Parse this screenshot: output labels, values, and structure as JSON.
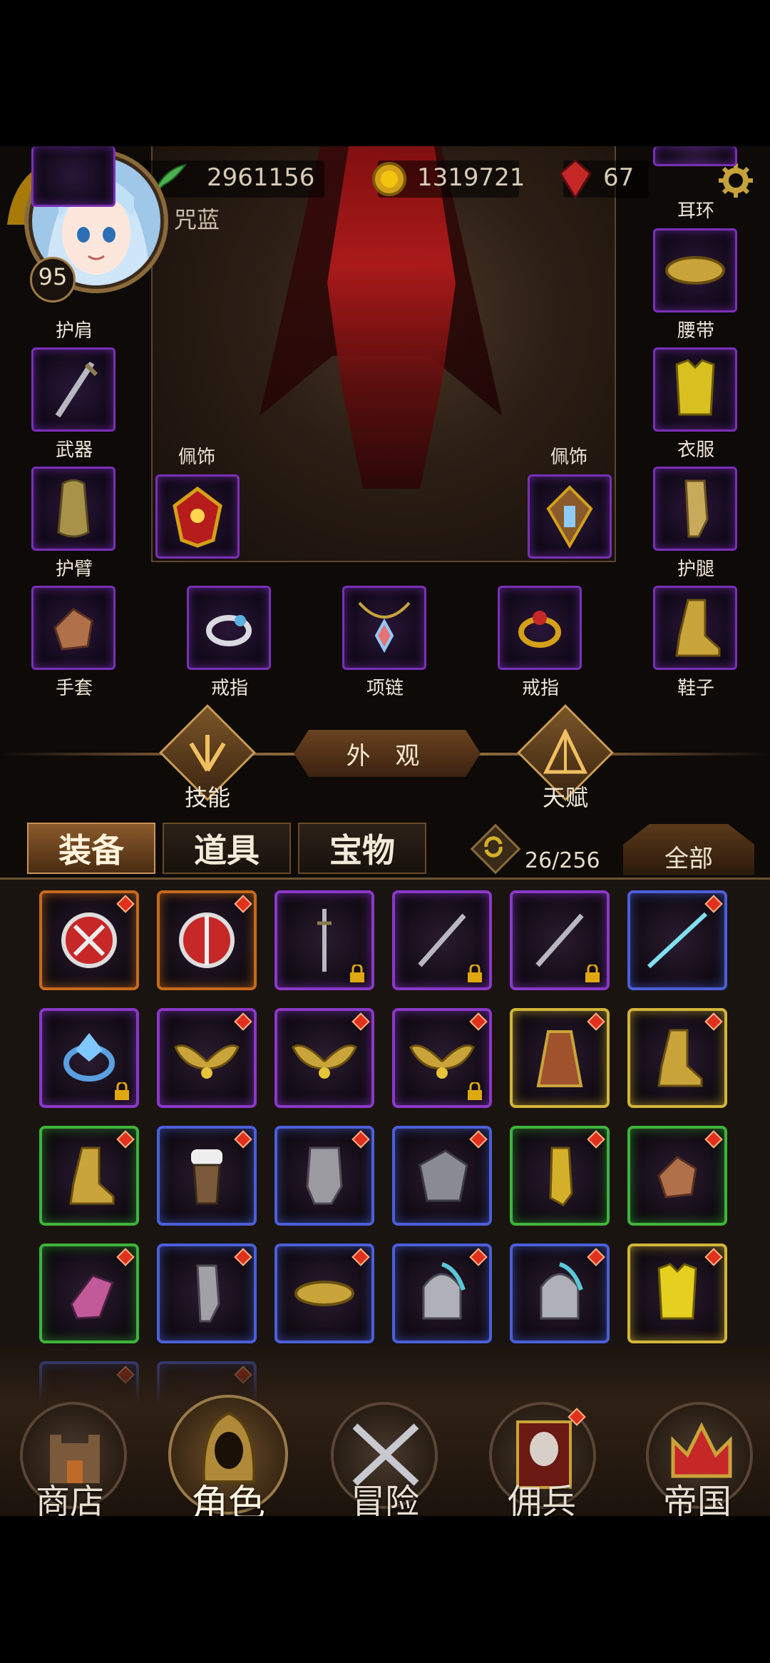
{
  "header": {
    "player_name": "咒蓝",
    "player_level": "95",
    "currency_primary": "2961156",
    "currency_gold": "1319721",
    "currency_gems": "67"
  },
  "slots": {
    "shoulder": "护肩",
    "weapon": "武器",
    "bracer": "护臂",
    "earring": "耳环",
    "belt": "腰带",
    "clothes": "衣服",
    "greaves": "护腿",
    "accessory_left": "佩饰",
    "accessory_right": "佩饰",
    "gloves": "手套",
    "ring_left": "戒指",
    "necklace": "项链",
    "ring_right": "戒指",
    "shoes": "鞋子"
  },
  "middle": {
    "skills_label": "技能",
    "appearance_label": "外 观",
    "talent_label": "天赋"
  },
  "tabs": {
    "equipment": "装备",
    "items": "道具",
    "treasure": "宝物",
    "capacity": "26/256",
    "filter": "全部"
  },
  "nav": {
    "shop": "商店",
    "character": "角色",
    "adventure": "冒险",
    "mercenary": "佣兵",
    "empire": "帝国"
  },
  "colors": {
    "quality_orange": "#c66a1c",
    "quality_purple": "#8a38c8",
    "quality_blue": "#4b5fd8",
    "quality_green": "#3eb43a",
    "quality_gold": "#d2b53a"
  }
}
